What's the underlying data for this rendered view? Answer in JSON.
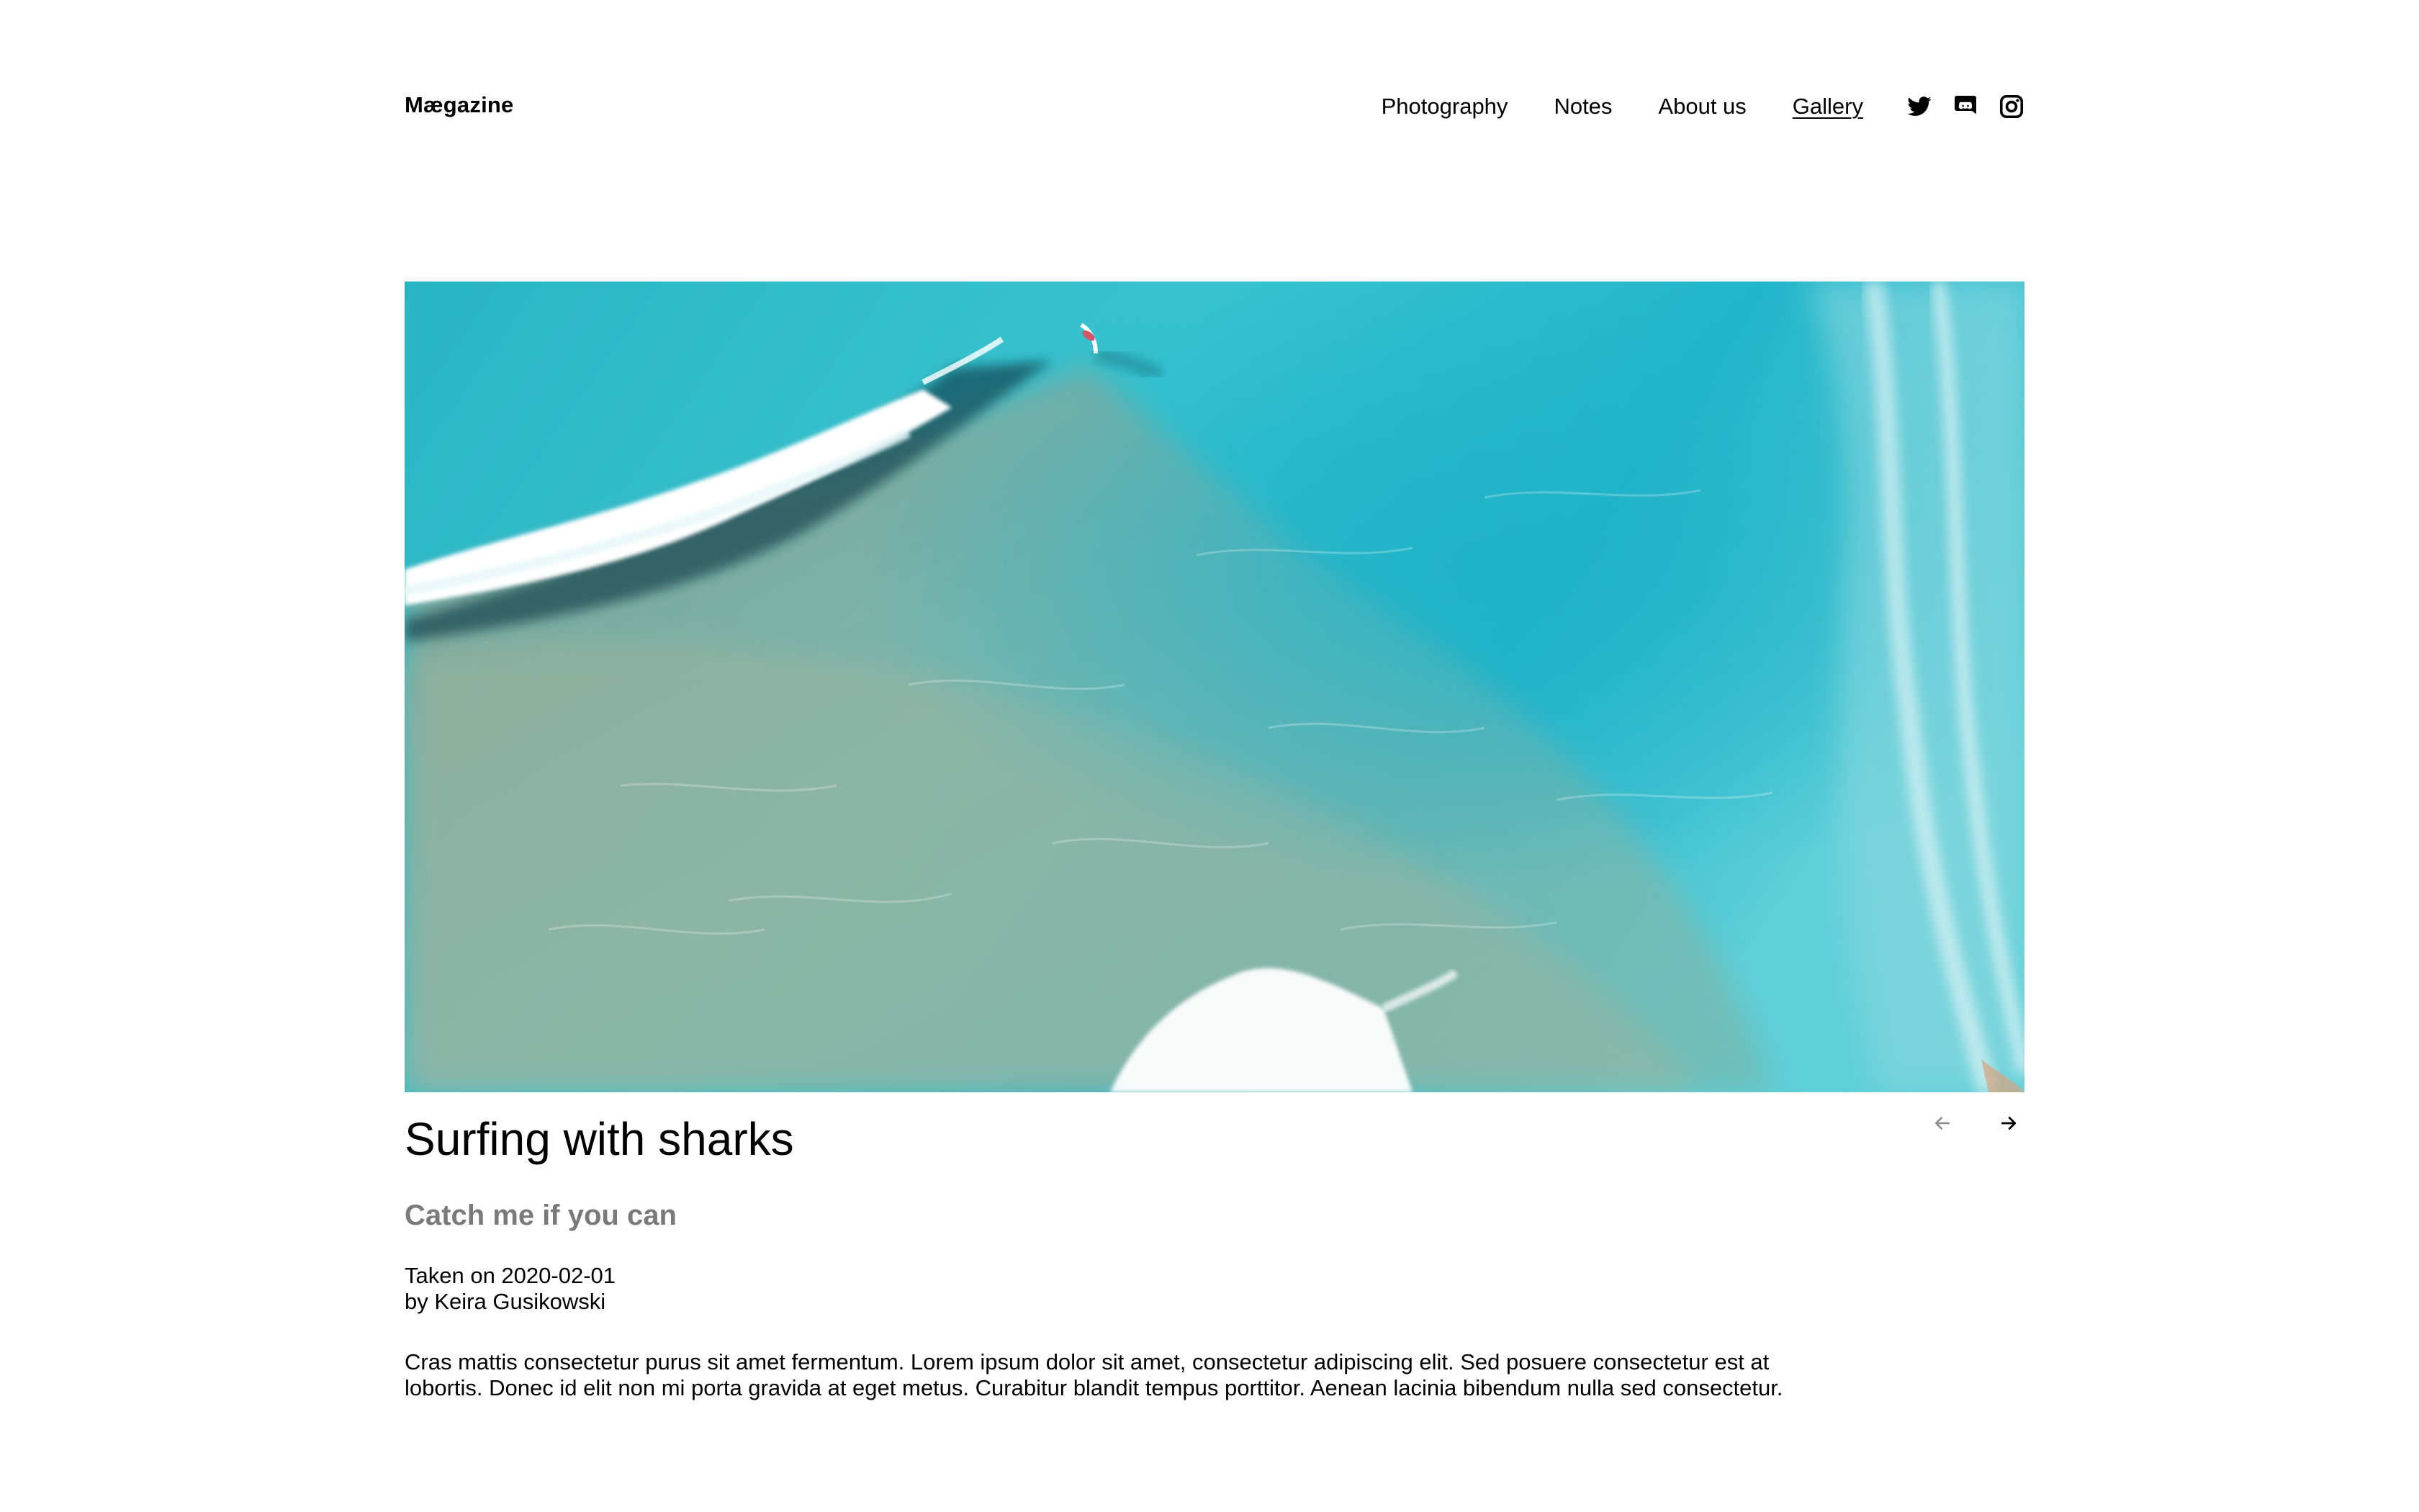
{
  "header": {
    "brand": "Mægazine",
    "nav": [
      {
        "label": "Photography",
        "active": false
      },
      {
        "label": "Notes",
        "active": false
      },
      {
        "label": "About us",
        "active": false
      },
      {
        "label": "Gallery",
        "active": true
      }
    ],
    "social_icons": [
      "twitter-icon",
      "discord-icon",
      "instagram-icon"
    ]
  },
  "photo": {
    "title": "Surfing with sharks",
    "subtitle": "Catch me if you can",
    "taken_on": "Taken on 2020-02-01",
    "author": "by Keira Gusikowski",
    "description": "Cras mattis consectetur purus sit amet fermentum. Lorem ipsum dolor sit amet, consectetur adipiscing elit. Sed posuere consectetur est at lobortis. Donec id elit non mi porta gravida at eget metus. Curabitur blandit tempus porttitor. Aenean lacinia bibendum nulla sed consectetur."
  },
  "pager": {
    "prev_icon": "arrow-left-icon",
    "next_icon": "arrow-right-icon",
    "prev_enabled": false,
    "next_enabled": true
  },
  "colors": {
    "text": "#000000",
    "subtitle": "#7a7a7a",
    "disabled_arrow": "#8a8a8a",
    "water_deep": "#23b3c6",
    "water_shallow": "#93b7a8",
    "foam": "#ffffff"
  }
}
